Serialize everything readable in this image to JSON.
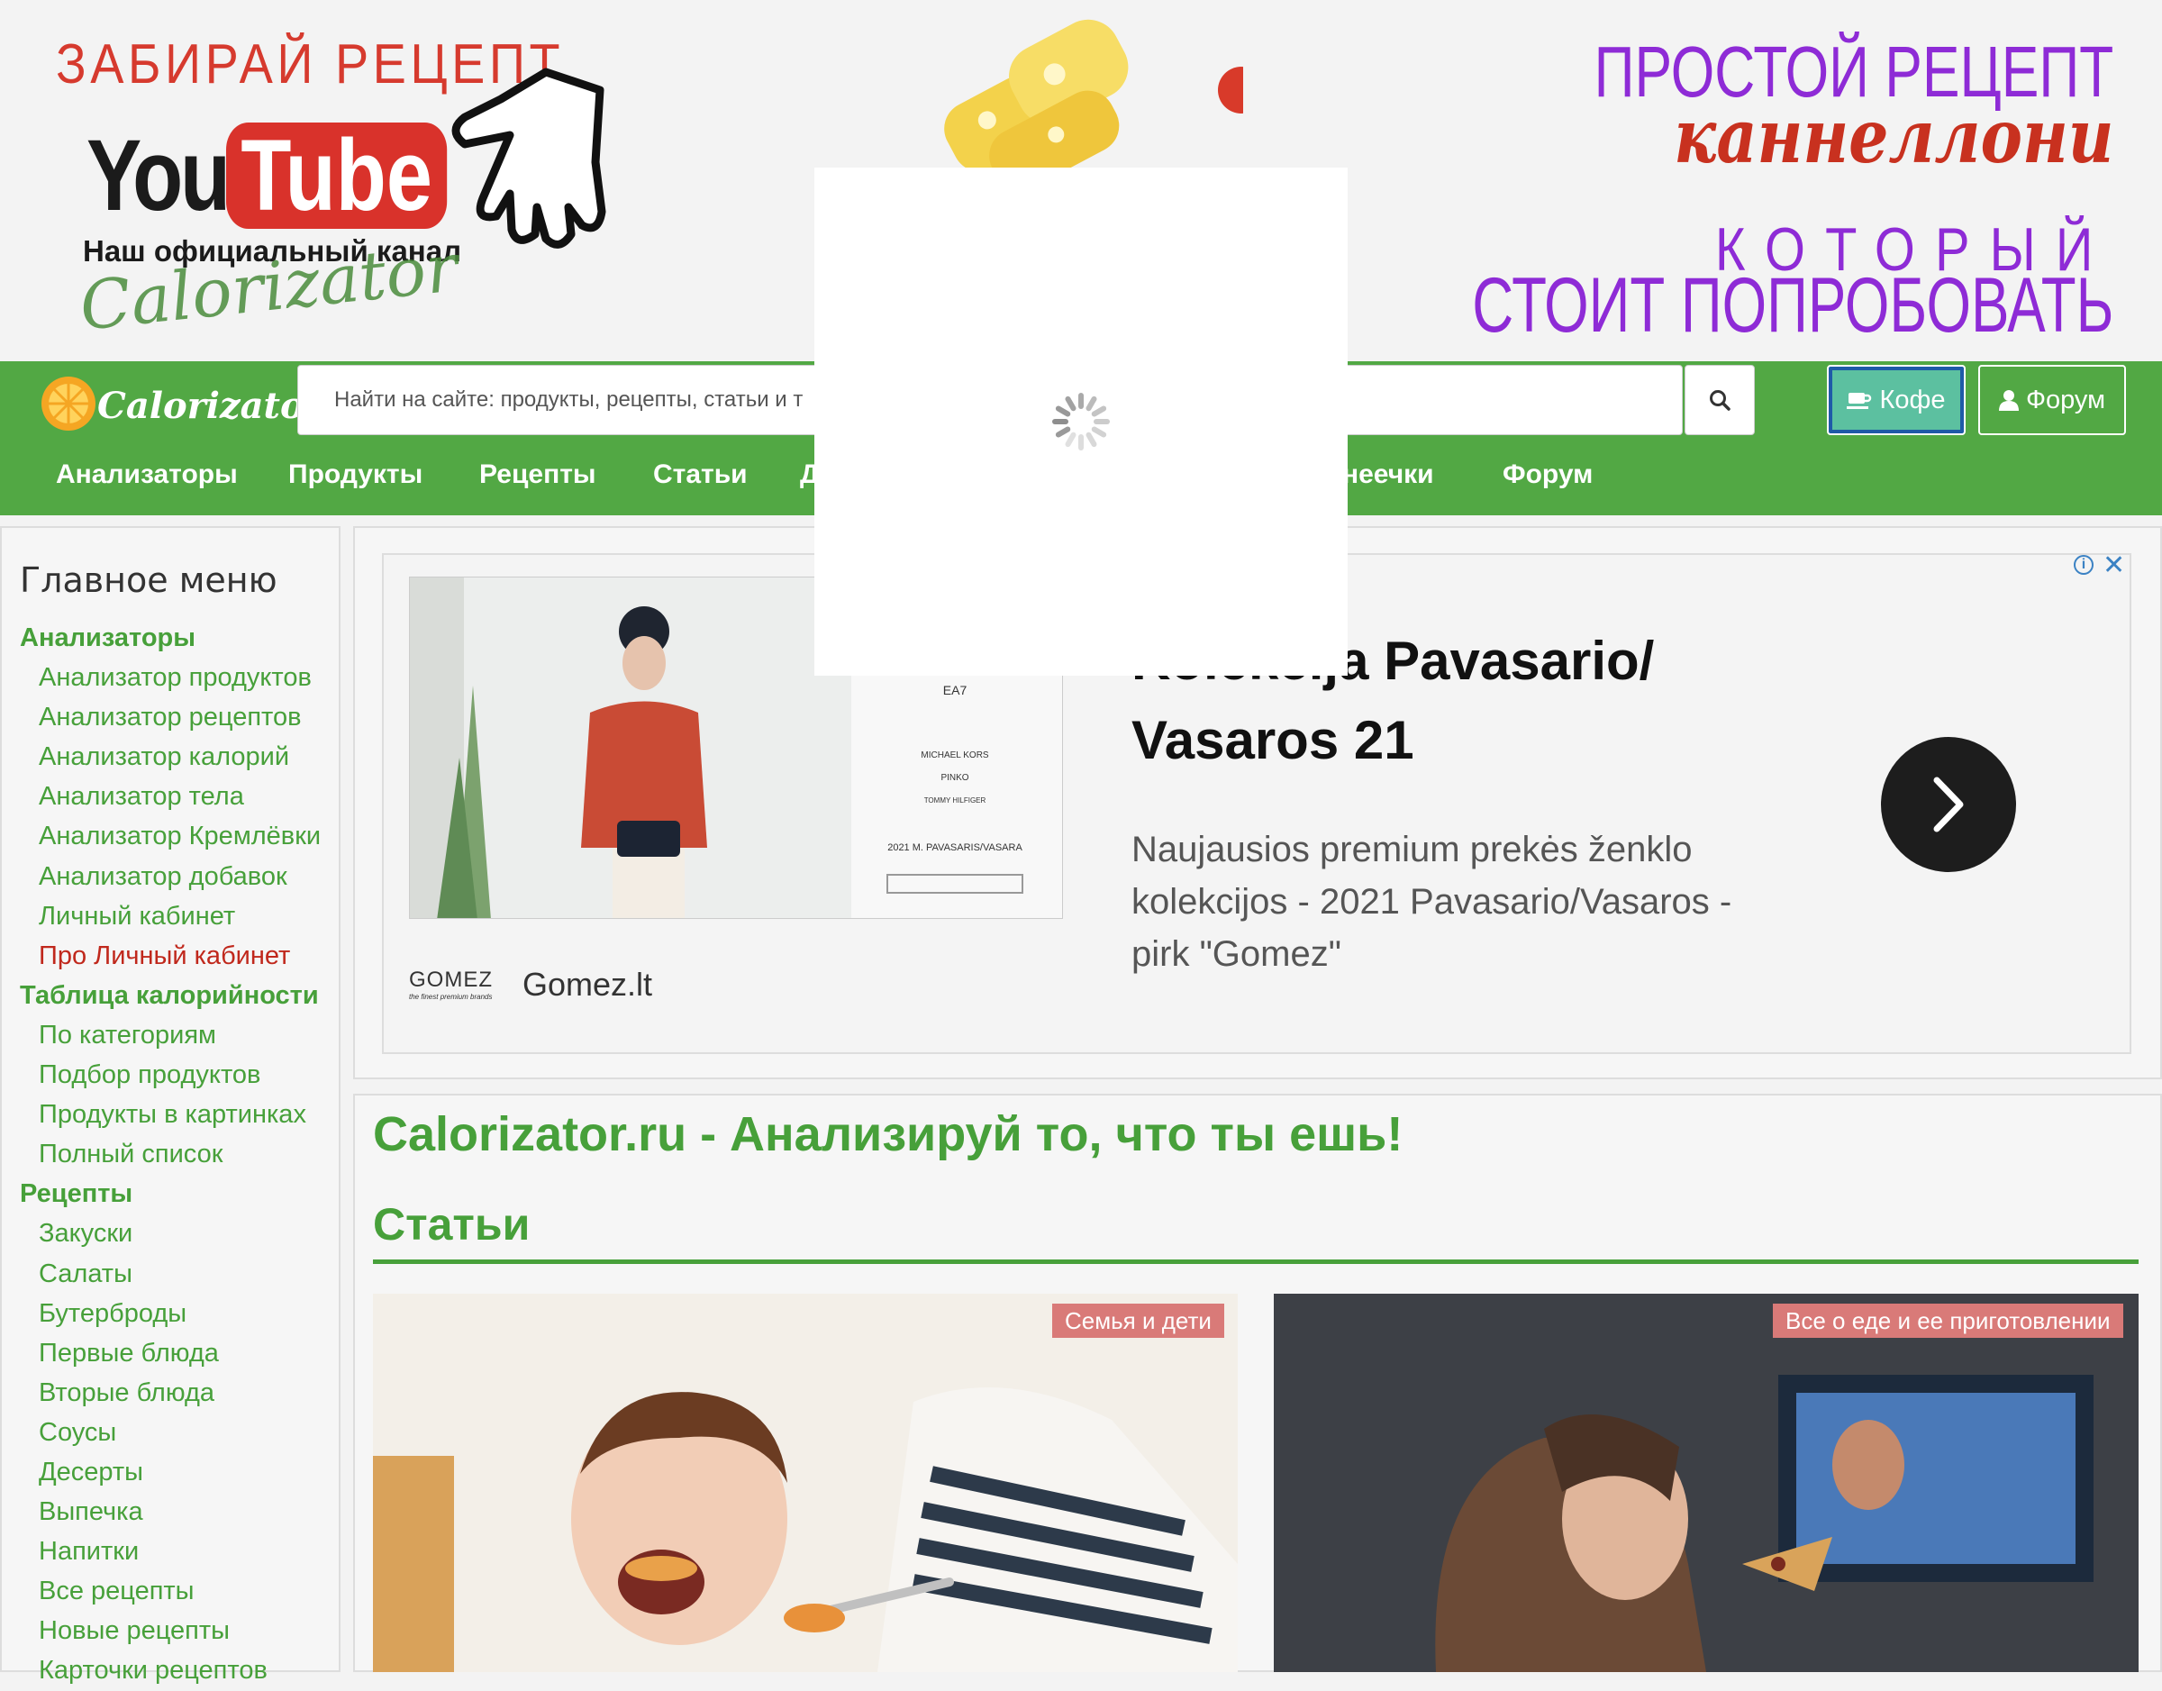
{
  "banner": {
    "youtube_tagline": "ЗАБИРАЙ РЕЦЕПТ",
    "youtube_you": "You",
    "youtube_tube": "Tube",
    "youtube_channel": "Наш официальный канал",
    "script_brand": "Calorizator",
    "promo_line1": "ПРОСТОЙ РЕЦЕПТ",
    "promo_line2": "каннеллони",
    "promo_line3": "КОТОРЫЙ",
    "promo_line4": "СТОИТ ПОПРОБОВАТЬ"
  },
  "header": {
    "logo_text": "Calorizator",
    "search_placeholder": "Найти на сайте: продукты, рецепты, статьи и т",
    "coffee_label": "Кофе",
    "forum_label": "Форум"
  },
  "nav": {
    "items": [
      {
        "label": "Анализаторы"
      },
      {
        "label": "Продукты"
      },
      {
        "label": "Рецепты"
      },
      {
        "label": "Статьи"
      },
      {
        "label": "Д"
      },
      {
        "label": "неечки"
      },
      {
        "label": "Форум"
      }
    ]
  },
  "sidebar": {
    "title": "Главное меню",
    "items": [
      {
        "label": "Анализаторы"
      },
      {
        "label": "Анализатор продуктов"
      },
      {
        "label": "Анализатор рецептов"
      },
      {
        "label": "Анализатор калорий"
      },
      {
        "label": "Анализатор тела"
      },
      {
        "label": "Анализатор Кремлёвки"
      },
      {
        "label": "Анализатор добавок"
      },
      {
        "label": "Личный кабинет"
      },
      {
        "label": "Про Личный кабинет"
      },
      {
        "label": "Таблица калорийности"
      },
      {
        "label": "По категориям"
      },
      {
        "label": "Подбор продуктов"
      },
      {
        "label": "Продукты в картинках"
      },
      {
        "label": "Полный список"
      },
      {
        "label": "Рецепты"
      },
      {
        "label": "Закуски"
      },
      {
        "label": "Салаты"
      },
      {
        "label": "Бутерброды"
      },
      {
        "label": "Первые блюда"
      },
      {
        "label": "Вторые блюда"
      },
      {
        "label": "Соусы"
      },
      {
        "label": "Десерты"
      },
      {
        "label": "Выпечка"
      },
      {
        "label": "Напитки"
      },
      {
        "label": "Все рецепты"
      },
      {
        "label": "Новые рецепты"
      },
      {
        "label": "Карточки рецептов"
      }
    ]
  },
  "ad": {
    "image_brands": [
      "EA7",
      "MICHAEL KORS",
      "PINKO",
      "TOMMY HILFIGER",
      "2021 M. PAVASARIS/VASARA"
    ],
    "brand_logo": "GOMEZ",
    "brand_logo_sub": "the finest premium brands",
    "brand_name": "Gomez.lt",
    "title_line1": "Kolekcija Pavasario/",
    "title_line2": "Vasaros 21",
    "description": "Naujausios premium prekės ženklo kolekcijos - 2021 Pavasario/Vasaros - pirk \"Gomez\""
  },
  "content": {
    "site_heading": "Calorizator.ru - Анализируй то, что ты ешь!",
    "section_heading": "Статьи",
    "cards": [
      {
        "badge": "Семья и дети"
      },
      {
        "badge": "Все о еде и ее приготовлении"
      }
    ]
  },
  "colors": {
    "brand_green": "#52a844",
    "link_green": "#47a03a",
    "promo_purple": "#8e2bd6",
    "youtube_red": "#d9322b",
    "badge_pink": "#d97a78"
  }
}
